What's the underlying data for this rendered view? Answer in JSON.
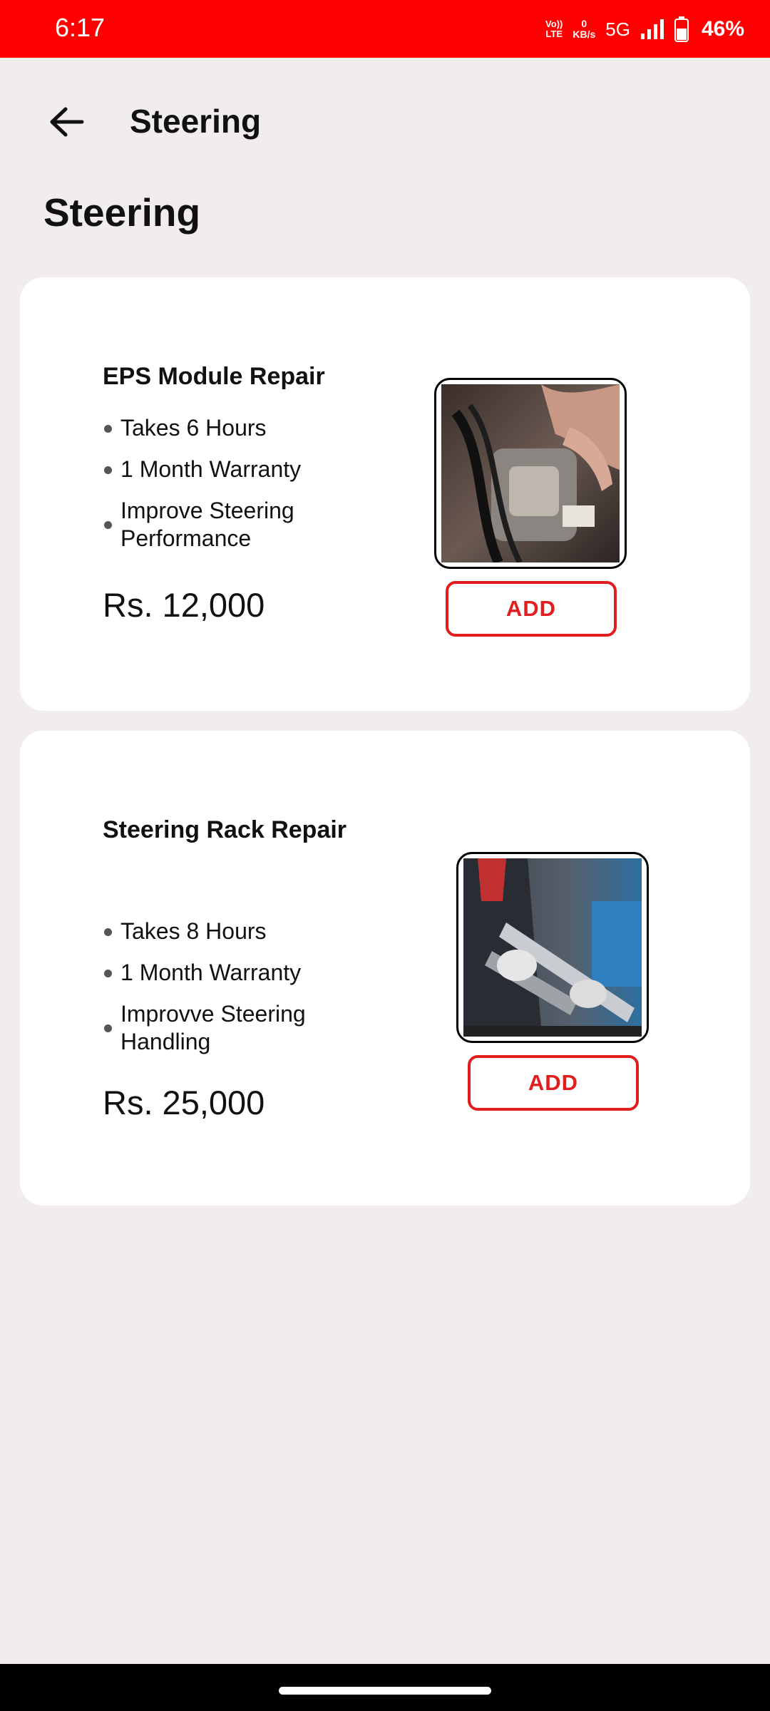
{
  "status_bar": {
    "time": "6:17",
    "volte_line1": "Vo))",
    "volte_line2": "LTE",
    "speed_value": "0",
    "speed_unit": "KB/s",
    "network": "5G",
    "battery": "46%"
  },
  "app_bar": {
    "title": "Steering",
    "back_icon": "arrow-left-icon"
  },
  "section": {
    "title": "Steering"
  },
  "services": [
    {
      "name": "EPS Module Repair",
      "features": [
        "Takes 6 Hours",
        "1 Month Warranty",
        "Improve Steering Performance"
      ],
      "price": "Rs. 12,000",
      "add_label": "ADD"
    },
    {
      "name": "Steering Rack Repair",
      "features": [
        "Takes 8 Hours",
        "1 Month Warranty",
        "Improvve Steering Handling"
      ],
      "price": "Rs. 25,000",
      "add_label": "ADD"
    }
  ],
  "colors": {
    "accent": "#ff0000",
    "button_red": "#e11d1d",
    "background": "#f1eded"
  }
}
